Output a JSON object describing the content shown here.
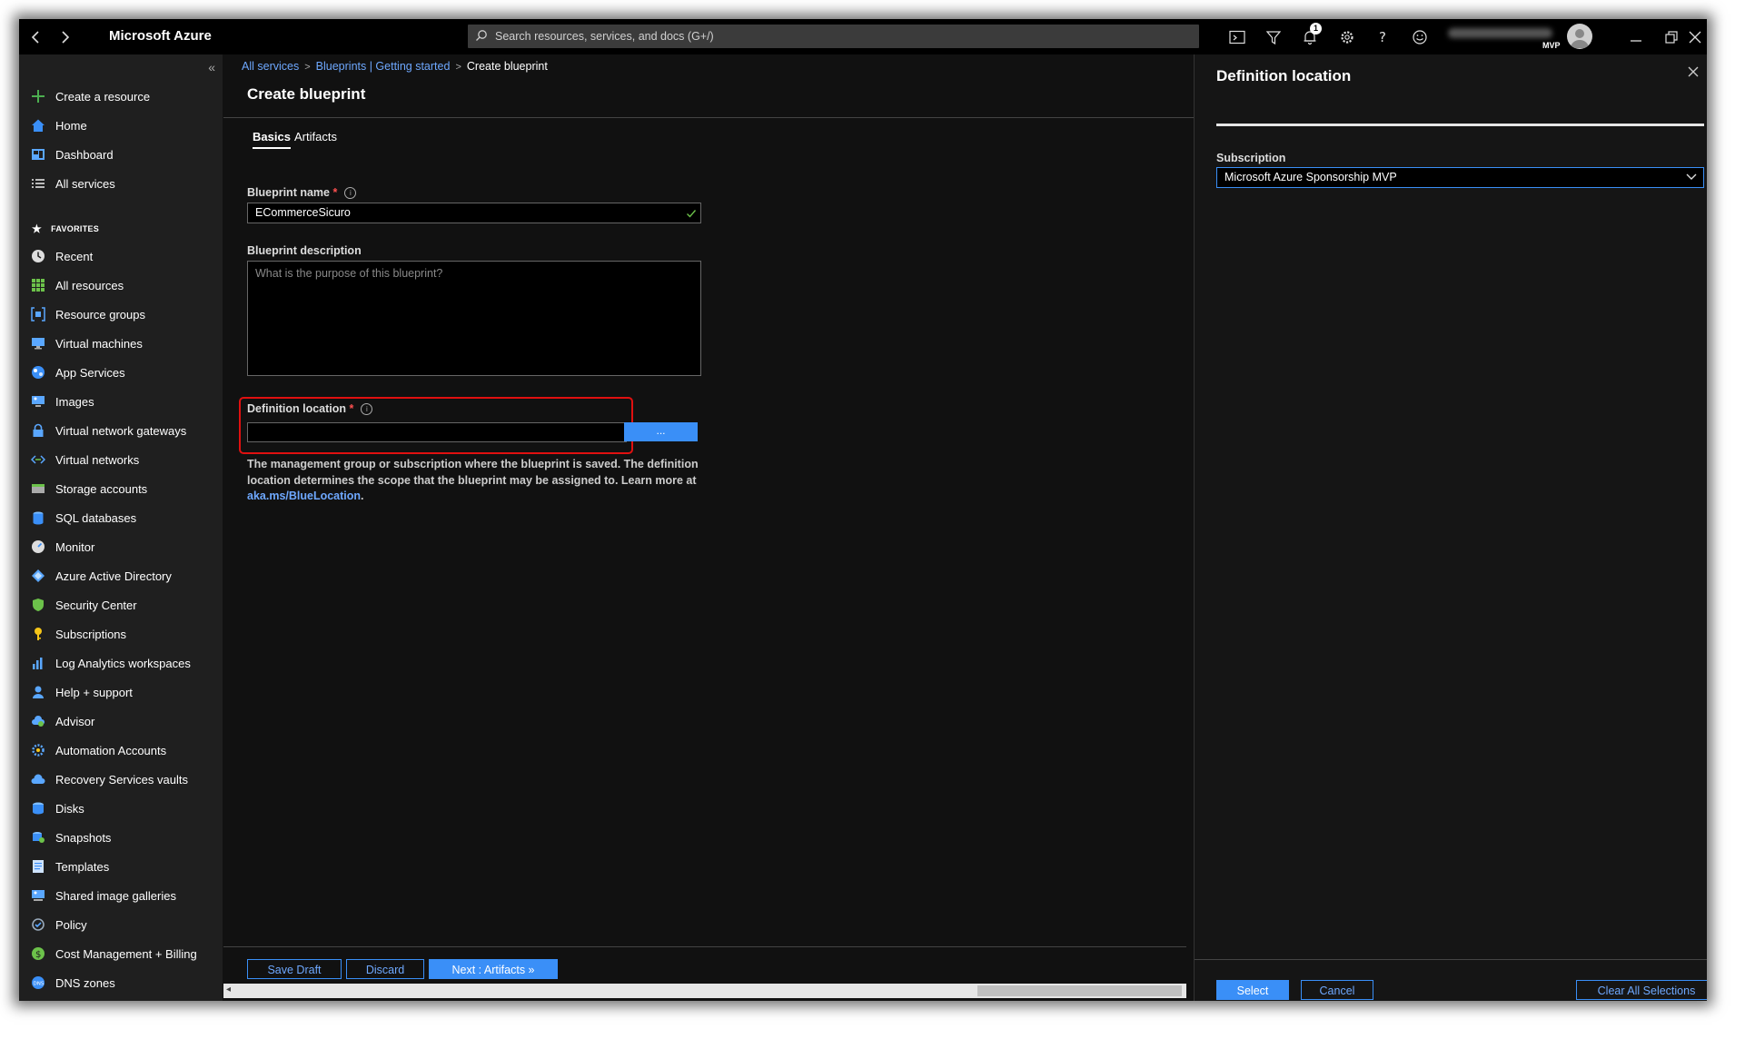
{
  "app": {
    "title": "Microsoft Azure"
  },
  "search": {
    "placeholder": "Search resources, services, and docs (G+/)"
  },
  "topbar": {
    "notification_count": "1",
    "account_tag": "MVP"
  },
  "sidebar": {
    "create": "Create a resource",
    "home": "Home",
    "dashboard": "Dashboard",
    "all_services": "All services",
    "favorites_label": "FAVORITES",
    "items": [
      "Recent",
      "All resources",
      "Resource groups",
      "Virtual machines",
      "App Services",
      "Images",
      "Virtual network gateways",
      "Virtual networks",
      "Storage accounts",
      "SQL databases",
      "Monitor",
      "Azure Active Directory",
      "Security Center",
      "Subscriptions",
      "Log Analytics workspaces",
      "Help + support",
      "Advisor",
      "Automation Accounts",
      "Recovery Services vaults",
      "Disks",
      "Snapshots",
      "Templates",
      "Shared image galleries",
      "Policy",
      "Cost Management + Billing",
      "DNS zones"
    ]
  },
  "breadcrumb": {
    "c1": "All services",
    "c2": "Blueprints | Getting started",
    "c3": "Create blueprint"
  },
  "page": {
    "title": "Create blueprint"
  },
  "tabs": {
    "basics": "Basics",
    "artifacts": "Artifacts"
  },
  "form": {
    "name_label": "Blueprint name",
    "name_value": "ECommerceSicuro",
    "desc_label": "Blueprint description",
    "desc_placeholder": "What is the purpose of this blueprint?",
    "loc_label": "Definition location",
    "loc_button": "...",
    "help_text": "The management group or subscription where the blueprint is saved. The definition location determines the scope that the blueprint may be assigned to. Learn more at ",
    "help_link": "aka.ms/BlueLocation",
    "help_end": "."
  },
  "footer": {
    "save_draft": "Save Draft",
    "discard": "Discard",
    "next": "Next : Artifacts »"
  },
  "panel": {
    "title": "Definition location",
    "subscription_label": "Subscription",
    "subscription_value": "Microsoft Azure Sponsorship MVP",
    "select": "Select",
    "cancel": "Cancel",
    "clear": "Clear All Selections"
  },
  "colors": {
    "accent": "#3a8ff7",
    "highlight": "#e01010",
    "background": "#111111"
  }
}
